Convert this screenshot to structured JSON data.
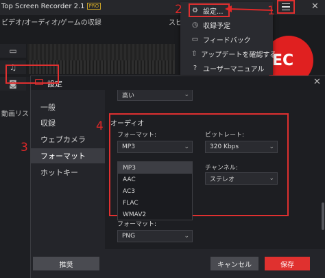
{
  "app": {
    "title": "Top Screen Recorder 2.1",
    "pro_badge": "PRO",
    "section_label": "ビデオ/オーディオ/ゲームの収録",
    "speaker_label": "スピ",
    "rec_label": "EC",
    "list_label": "動画リスト",
    "close_glyph": "✕"
  },
  "annotations": {
    "a1": "1",
    "a2": "2",
    "a3": "3",
    "a4": "4"
  },
  "menu": {
    "items": [
      {
        "icon": "gear-icon",
        "glyph": "⚙",
        "label": "設定..."
      },
      {
        "icon": "clock-icon",
        "glyph": "◷",
        "label": "収録予定"
      },
      {
        "icon": "chat-icon",
        "glyph": "▭",
        "label": "フィードバック"
      },
      {
        "icon": "upload-icon",
        "glyph": "⇧",
        "label": "アップデートを確認する"
      },
      {
        "icon": "help-icon",
        "glyph": "?",
        "label": "ユーザーマニュアル"
      }
    ]
  },
  "dialog": {
    "title": "設定",
    "close_glyph": "✕",
    "nav": [
      "一般",
      "収録",
      "ウェブカメラ",
      "フォーマット",
      "ホットキー"
    ],
    "active_nav": "フォーマット",
    "top_select_value": "高い",
    "audio": {
      "section_title": "オーディオ",
      "format_label": "フォーマット:",
      "format_value": "MP3",
      "format_options": [
        "MP3",
        "AAC",
        "AC3",
        "FLAC",
        "WMAV2"
      ],
      "bitrate_label": "ビットレート:",
      "bitrate_value": "320 Kbps",
      "channel_label": "チャンネル:",
      "channel_value": "ステレオ"
    },
    "image": {
      "format_label": "フォーマット:",
      "format_value": "PNG"
    },
    "footer": {
      "default_label": "推奨",
      "cancel_label": "キャンセル",
      "save_label": "保存"
    }
  },
  "colors": {
    "accent": "#e0312f",
    "background": "#1e1f23",
    "annotation": "#e02828"
  }
}
